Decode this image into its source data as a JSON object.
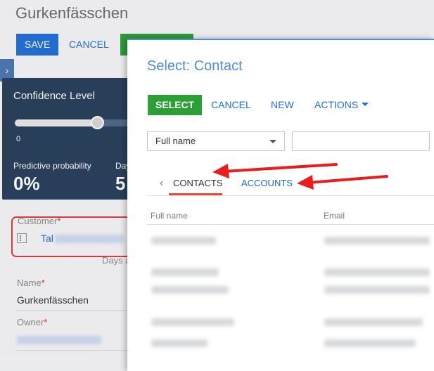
{
  "page": {
    "title": "Gurkenfässchen",
    "save_label": "SAVE",
    "cancel_label": "CANCEL",
    "side_tab_icon": "chevron-right-icon"
  },
  "confidence": {
    "title": "Confidence Level",
    "slider_min": "0",
    "slider_level": 0.7,
    "predictive_label": "Predictive probability",
    "predictive_value": "0%",
    "days_label": "Day",
    "days_value": "5"
  },
  "fields": {
    "customer_label": "Customer",
    "customer_value": "Tal",
    "customer_tail": "H",
    "days_after": "Days a",
    "name_label": "Name",
    "name_value": "Gurkenfässchen",
    "owner_label": "Owner",
    "required_mark": "*"
  },
  "modal": {
    "title": "Select: Contact",
    "buttons": {
      "select": "SELECT",
      "cancel": "CANCEL",
      "new": "NEW",
      "actions": "ACTIONS"
    },
    "filter_field": "Full name",
    "filter_value": "",
    "tabs": [
      {
        "label": "CONTACTS",
        "active": true
      },
      {
        "label": "ACCOUNTS",
        "active": false
      }
    ],
    "columns": [
      "Full name",
      "Email"
    ]
  },
  "colors": {
    "primary_blue": "#1f6fd4",
    "green": "#2ca036",
    "panel_dark": "#283e5a",
    "annotation_red": "#e81e1e"
  }
}
